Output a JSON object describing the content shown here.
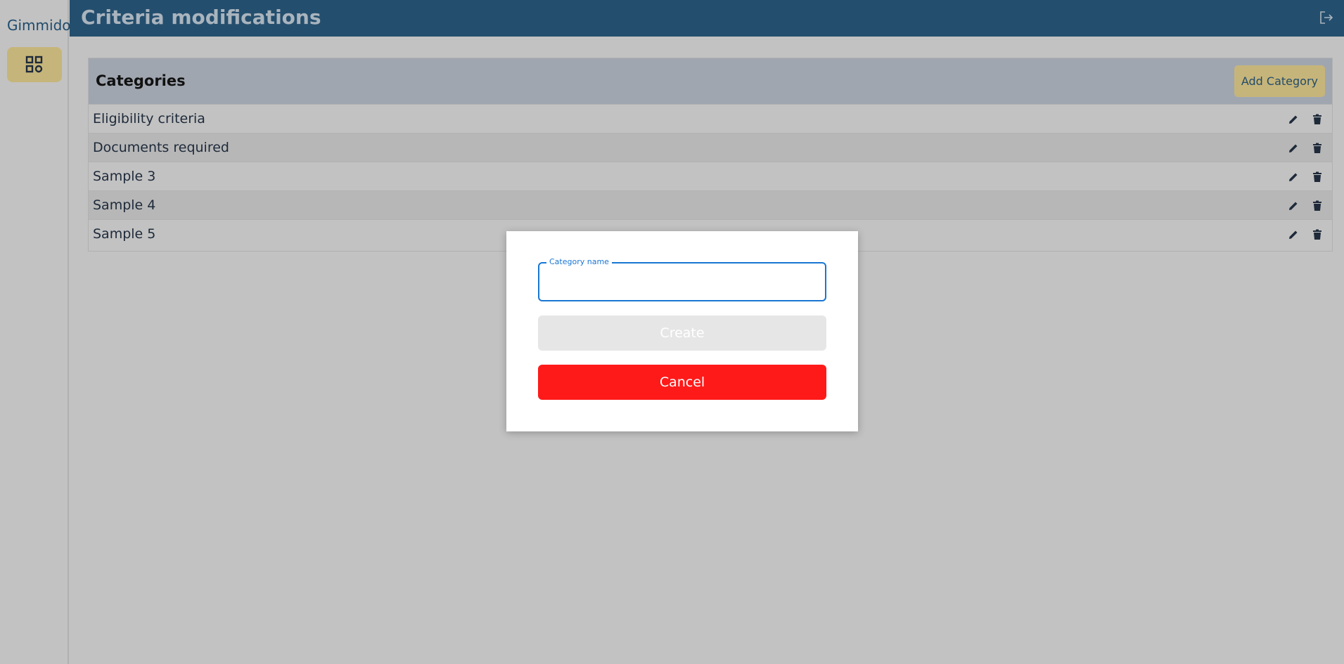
{
  "sidebar": {
    "brand": "Gimmido",
    "nav_icon": "grid-dashboard-icon"
  },
  "header": {
    "title": "Criteria modifications",
    "logout_icon": "logout-icon"
  },
  "panel": {
    "title": "Categories",
    "add_button_label": "Add Category",
    "rows": [
      {
        "label": "Eligibility criteria"
      },
      {
        "label": "Documents required"
      },
      {
        "label": "Sample 3"
      },
      {
        "label": "Sample 4"
      },
      {
        "label": "Sample 5"
      }
    ]
  },
  "modal": {
    "field_label": "Category name",
    "field_value": "",
    "create_label": "Create",
    "cancel_label": "Cancel"
  },
  "colors": {
    "header_bg": "#244e6d",
    "accent_gold": "#c6b57a",
    "cancel_red": "#ff1a1a",
    "focus_blue": "#1976d2"
  }
}
